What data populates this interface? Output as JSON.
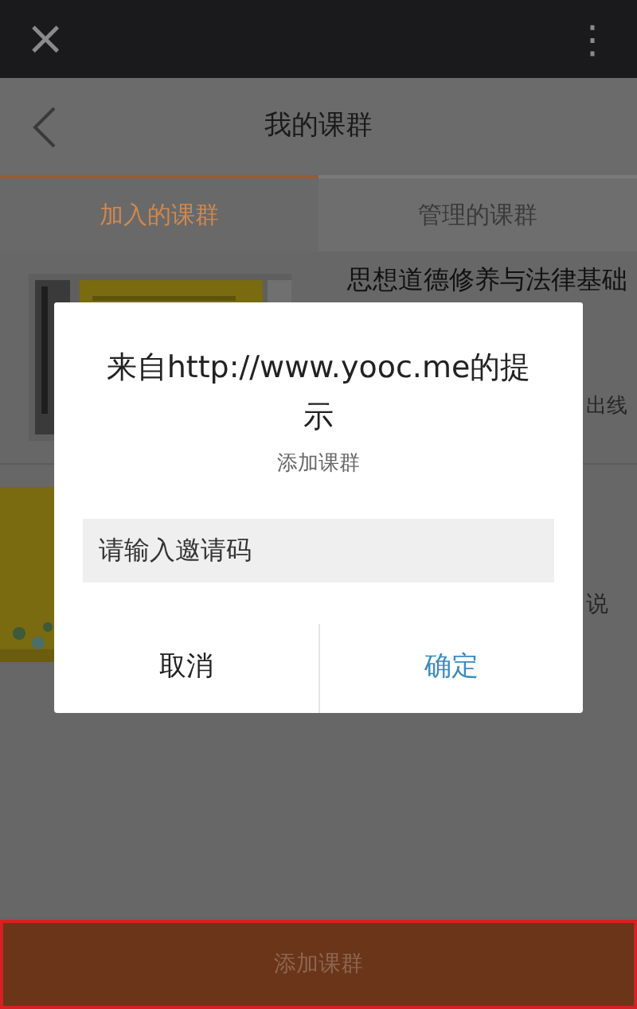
{
  "top_bar": {
    "close": "×",
    "menu": "⋮"
  },
  "header": {
    "title": "我的课群"
  },
  "tabs": [
    {
      "label": "加入的课群",
      "selected": true
    },
    {
      "label": "管理的课群",
      "selected": false
    }
  ],
  "courses": [
    {
      "title": "思想道德修养与法律基础",
      "note": "出线"
    },
    {
      "note": "说"
    }
  ],
  "dialog": {
    "title": "来自http://www.yooc.me的提示",
    "message": "添加课群",
    "input": {
      "placeholder": "请输入邀请码"
    },
    "buttons": [
      {
        "label": "取消",
        "kind": "cancel"
      },
      {
        "label": "确定",
        "kind": "confirm"
      }
    ]
  },
  "bottom_button": {
    "label": "添加课群"
  }
}
